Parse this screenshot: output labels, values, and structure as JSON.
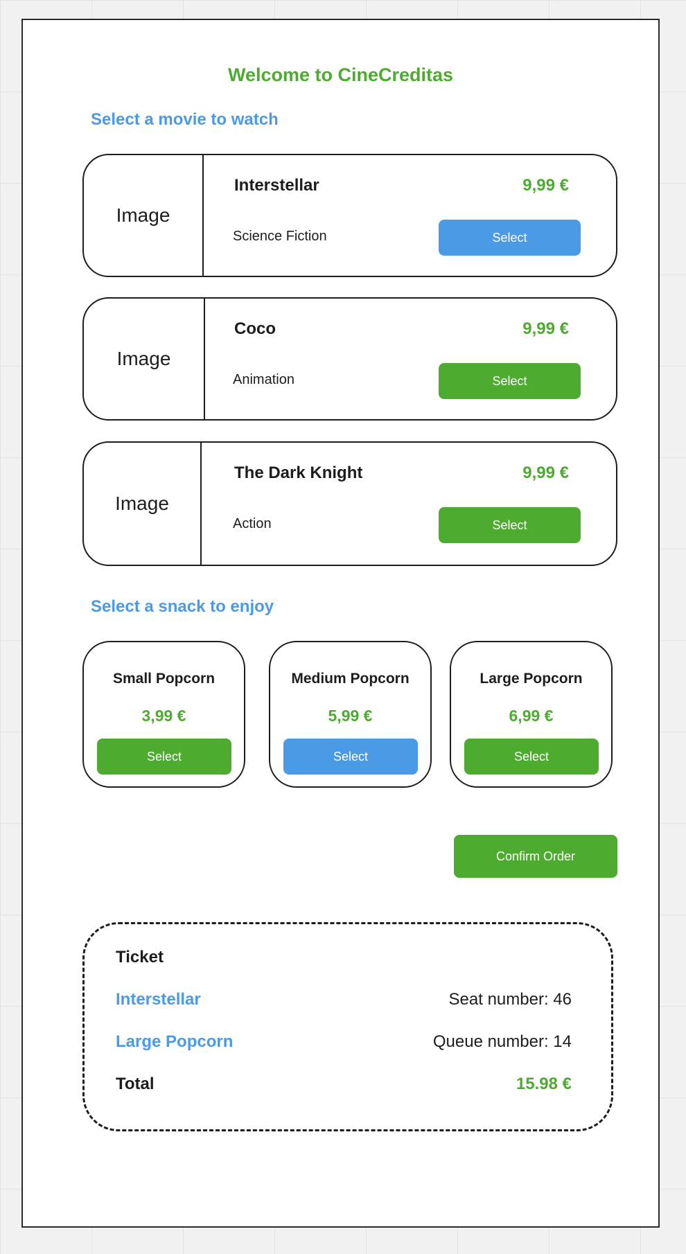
{
  "page": {
    "title": "Welcome to CineCreditas",
    "movies_heading": "Select a movie to watch",
    "snacks_heading": "Select a snack to enjoy"
  },
  "movies": [
    {
      "image_label": "Image",
      "name": "Interstellar",
      "genre": "Science Fiction",
      "price": "9,99 €",
      "button": "Select",
      "selected": true
    },
    {
      "image_label": "Image",
      "name": "Coco",
      "genre": "Animation",
      "price": "9,99 €",
      "button": "Select",
      "selected": false
    },
    {
      "image_label": "Image",
      "name": "The Dark Knight",
      "genre": "Action",
      "price": "9,99 €",
      "button": "Select",
      "selected": false
    }
  ],
  "snacks": [
    {
      "name": "Small Popcorn",
      "price": "3,99 €",
      "button": "Select",
      "selected": false
    },
    {
      "name": "Medium Popcorn",
      "price": "5,99 €",
      "button": "Select",
      "selected": true
    },
    {
      "name": "Large Popcorn",
      "price": "6,99 €",
      "button": "Select",
      "selected": false
    }
  ],
  "confirm_button": "Confirm Order",
  "ticket": {
    "heading": "Ticket",
    "movie": "Interstellar",
    "seat": "Seat number: 46",
    "snack": "Large Popcorn",
    "queue": "Queue number: 14",
    "total_label": "Total",
    "total_value": "15.98 €"
  },
  "colors": {
    "accent_green": "#4dab2f",
    "accent_blue": "#4b9ae6",
    "text": "#1d1d1d"
  }
}
